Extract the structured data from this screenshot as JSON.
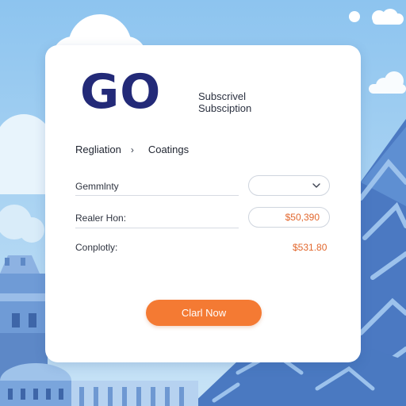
{
  "brand": {
    "logo_text": "GO",
    "subtitle_line1": "Subscrivel",
    "subtitle_line2": "Subsciption"
  },
  "breadcrumb": {
    "item1": "Regliation",
    "separator": "›",
    "item2": "Coatings"
  },
  "form": {
    "rows": [
      {
        "label": "Gemmlnty",
        "value": "",
        "control": "dropdown"
      },
      {
        "label": "Realer Hon:",
        "value": "$50,390",
        "control": "field"
      },
      {
        "label": "Conplotly:",
        "value": "$531.80",
        "control": "text"
      }
    ]
  },
  "cta": {
    "label": "Clarl Now"
  },
  "colors": {
    "brand": "#232a78",
    "accent": "#f47a33",
    "value": "#e2672d",
    "sky": "#9ccbef",
    "mountain": "#4f7fc4"
  },
  "icons": {
    "dropdown": "chevron-down-icon"
  }
}
